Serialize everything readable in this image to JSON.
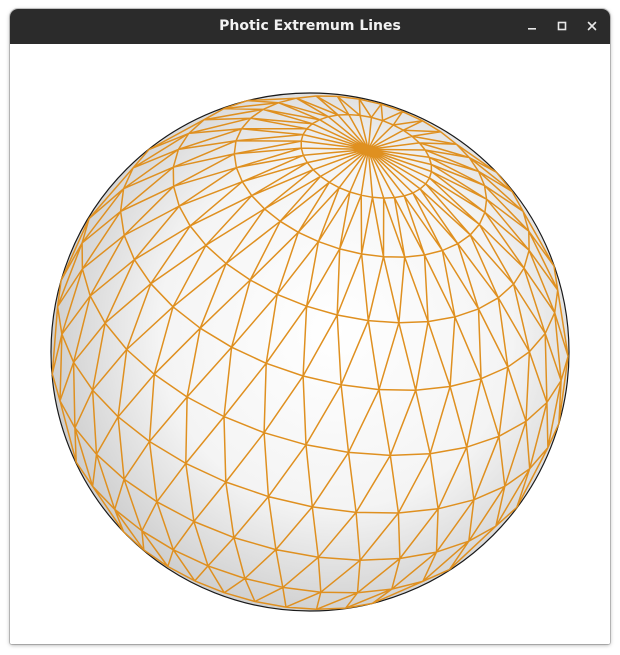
{
  "window": {
    "title": "Photic Extremum Lines"
  },
  "titlebar_buttons": {
    "minimize_icon": "minimize-icon",
    "maximize_icon": "maximize-icon",
    "close_icon": "close-icon"
  },
  "viewport": {
    "object": "sphere-mesh",
    "line_color": "#df9020",
    "shade_center": "#ffffff",
    "shade_edge": "#c4c4c4",
    "background": "#ffffff"
  }
}
